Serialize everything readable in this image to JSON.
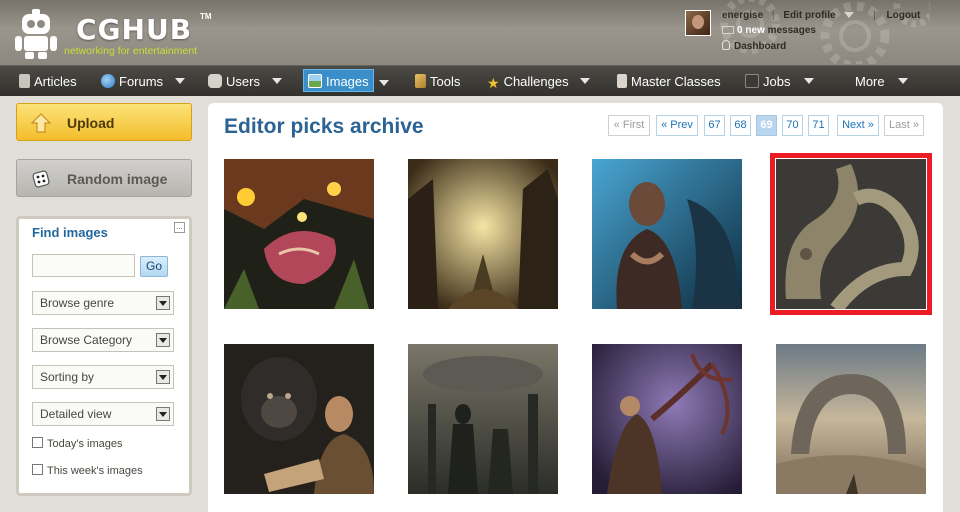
{
  "logo": {
    "name": "CGHUB",
    "tm": "TM",
    "tagline": "networking for entertainment"
  },
  "user": {
    "name": "energise",
    "edit_profile": "Edit profile",
    "logout": "Logout",
    "messages_count": "0 new",
    "messages_label": "messages",
    "dashboard": "Dashboard",
    "separator": "|"
  },
  "nav": {
    "items": [
      {
        "label": "Articles",
        "icon": "articles-icon"
      },
      {
        "label": "Forums",
        "icon": "globe-icon"
      },
      {
        "label": "Users",
        "icon": "robot-icon"
      },
      {
        "label": "Images",
        "icon": "image-icon",
        "active": true
      },
      {
        "label": "Tools",
        "icon": "tools-icon"
      },
      {
        "label": "Challenges",
        "icon": "star-icon"
      },
      {
        "label": "Master Classes",
        "icon": "masterclass-icon"
      },
      {
        "label": "Jobs",
        "icon": "briefcase-icon"
      },
      {
        "label": "More"
      }
    ]
  },
  "sidebar": {
    "upload_label": "Upload",
    "random_label": "Random image",
    "find": {
      "title": "Find images",
      "collapse_symbol": "...",
      "go_label": "Go",
      "search_value": "",
      "genre": "Browse genre",
      "category": "Browse Category",
      "sorting": "Sorting by",
      "view": "Detailed view",
      "today": "Today's images",
      "this_week": "This week's images"
    }
  },
  "main": {
    "title": "Editor picks archive",
    "pager": {
      "first": "« First",
      "prev": "« Prev",
      "pages": [
        "67",
        "68",
        "69",
        "70",
        "71"
      ],
      "current": "69",
      "next": "Next »",
      "last": "Last »"
    }
  },
  "colors": {
    "accent_blue": "#2b6393",
    "nav_active": "#3a8fca",
    "upload_yellow": "#f3bd2b",
    "selection_red": "#ec1c24",
    "tagline_green": "#c9df33"
  }
}
